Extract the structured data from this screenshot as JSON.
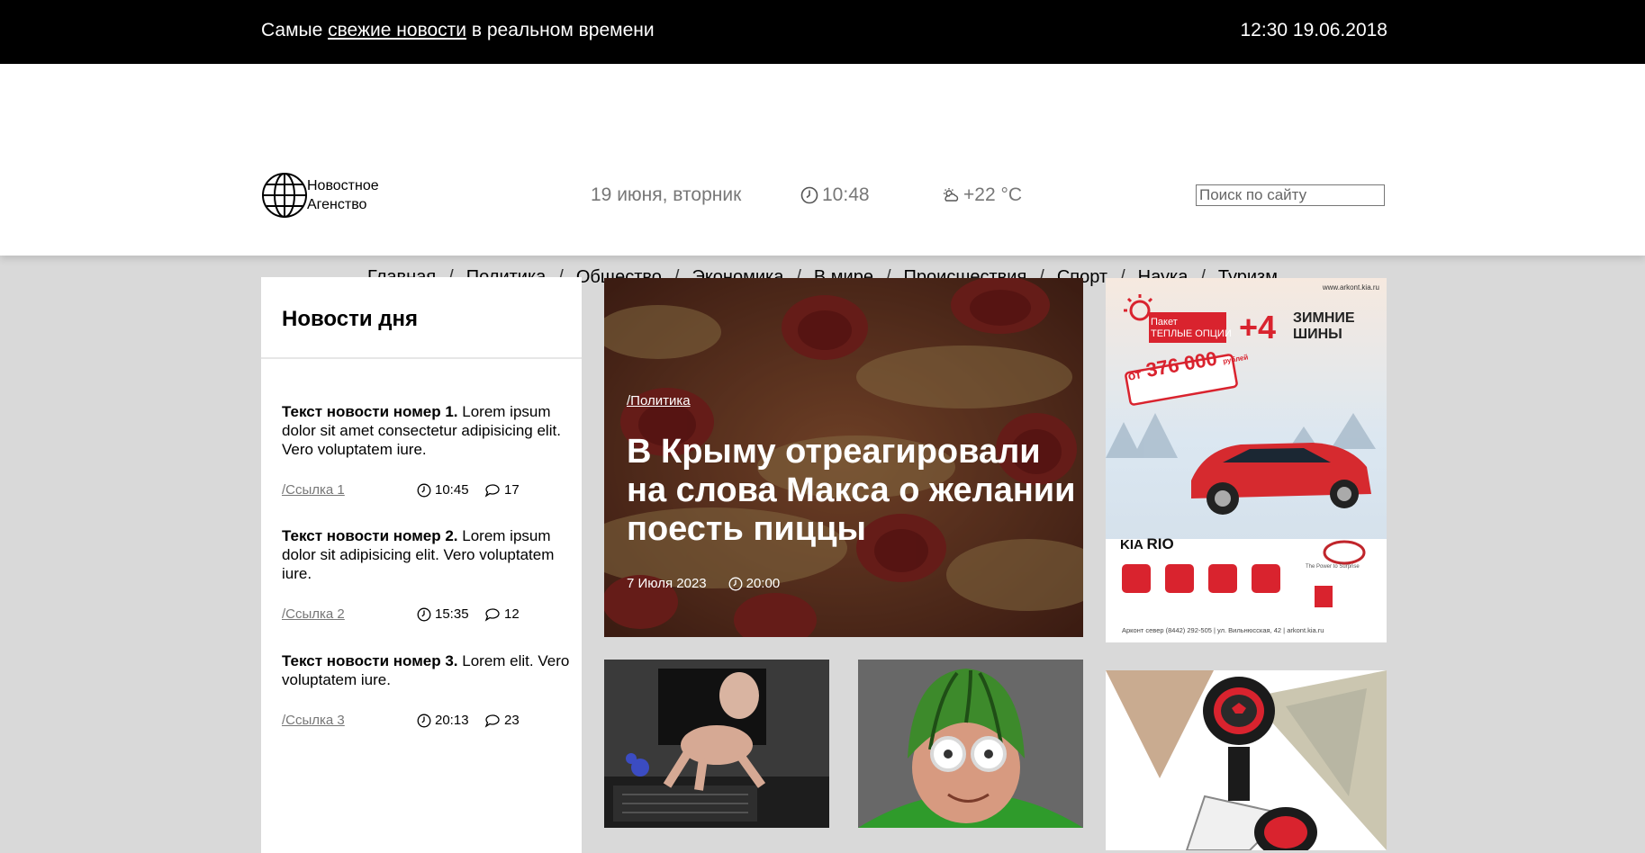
{
  "topbar": {
    "tagline_before": "Самые ",
    "tagline_link": "свежие новости",
    "tagline_after": " в реальном времени",
    "datetime": "12:30 19.06.2018"
  },
  "header": {
    "logo_line1": "Новостное",
    "logo_line2": "Агенство",
    "date": "19 июня, вторник",
    "time": "10:48",
    "weather": "+22 °C",
    "search_placeholder": "Поиск по сайту"
  },
  "nav": {
    "items": [
      "Главная",
      "Политика",
      "Общество",
      "Экономика",
      "В мире",
      "Происшествия",
      "Спорт",
      "Наука",
      "Туризм"
    ],
    "separator": "/"
  },
  "sidebar": {
    "title": "Новости дня",
    "news": [
      {
        "bold": "Текст новости номер 1.",
        "text": " Lorem ipsum dolor sit amet consectetur adipisicing elit. Vero voluptatem iure.",
        "link": "/Ссылка 1",
        "time": "10:45",
        "comments": "17"
      },
      {
        "bold": "Текст новости номер 2.",
        "text": " Lorem ipsum dolor sit adipisicing elit. Vero voluptatem iure.",
        "link": "/Ссылка 2",
        "time": "15:35",
        "comments": "12"
      },
      {
        "bold": "Текст новости номер 3.",
        "text": " Lorem elit. Vero voluptatem iure.",
        "link": "/Ссылка 3",
        "time": "20:13",
        "comments": "23"
      }
    ]
  },
  "featured": {
    "category": "/Политика",
    "title": "В Крыму отреагировали на слова Макса о желании поесть пиццы",
    "date": "7 Июля 2023",
    "time": "20:00"
  },
  "ad1": {
    "url": "www.arkont.kia.ru",
    "package_line1": "Пакет",
    "package_line2": "ТЕПЛЫЕ ОПЦИИ",
    "plus": "+4",
    "tires_line1": "ЗИМНИЕ",
    "tires_line2": "ШИНЫ",
    "price_prefix": "от",
    "price": "376 000",
    "price_suffix": "рублей",
    "model_brand": "KIA",
    "model_name": "RIO",
    "slogan": "The Power to Surprise",
    "footer": "Арконт север (8442) 292-505 | ул. Вильнюсская, 42 | arkont.kia.ru"
  },
  "colors": {
    "topbar_bg": "#000000",
    "page_bg": "#d9d9d9",
    "accent_red": "#d9232e"
  },
  "icons": [
    "globe-icon",
    "clock-icon",
    "weather-icon",
    "comment-icon"
  ]
}
